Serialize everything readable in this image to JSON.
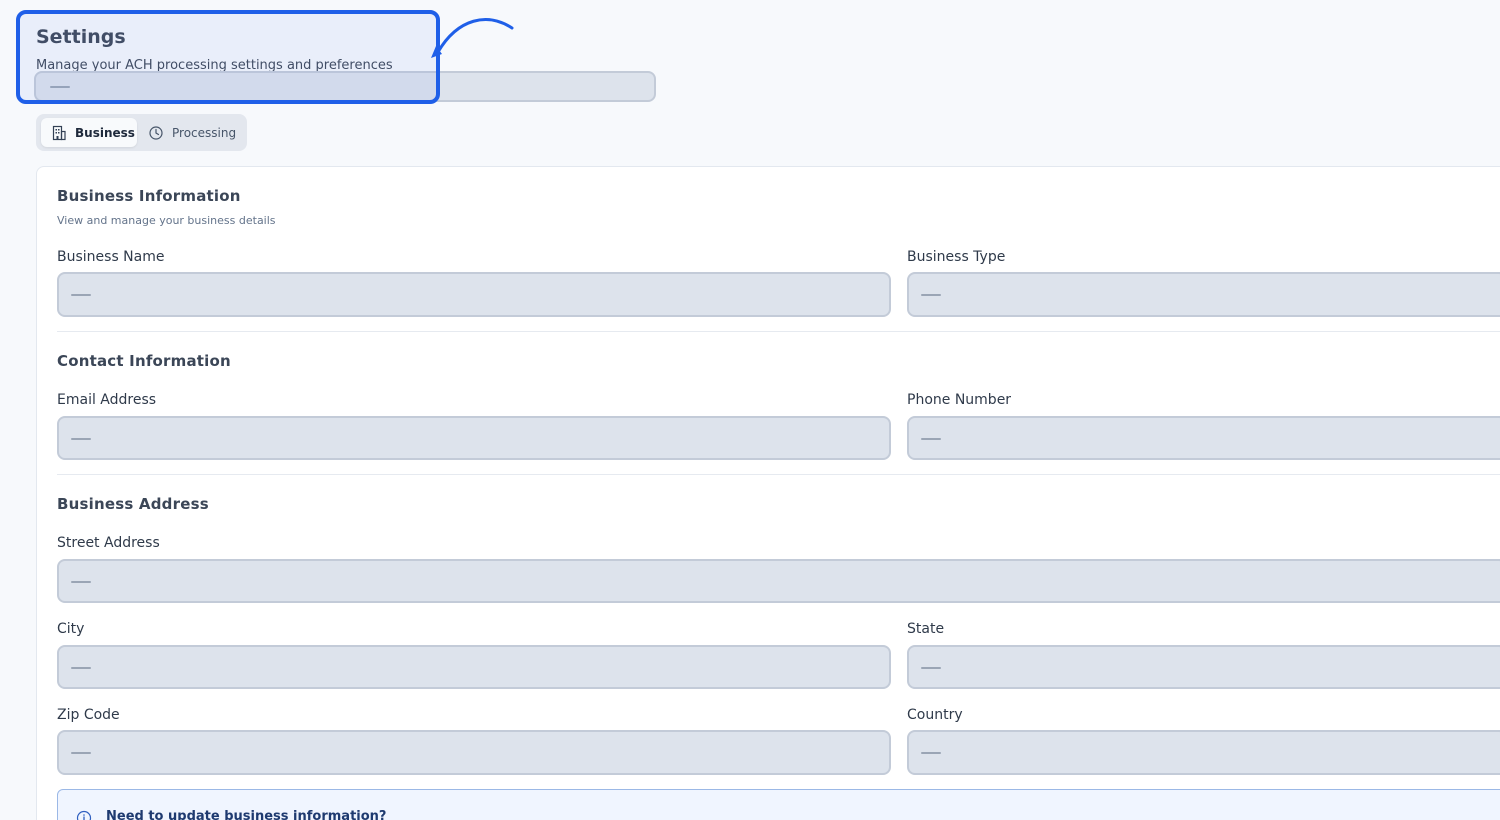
{
  "header": {
    "title": "Settings",
    "subtitle": "Manage your ACH processing settings and preferences"
  },
  "tabs": [
    {
      "label": "Business",
      "icon": "building-icon",
      "active": true
    },
    {
      "label": "Processing",
      "icon": "clock-icon",
      "active": false
    }
  ],
  "sections": {
    "business_info": {
      "title": "Business Information",
      "description": "View and manage your business details",
      "business_name_label": "Business Name",
      "business_type_label": "Business Type"
    },
    "contact_info": {
      "title": "Contact Information",
      "email_label": "Email Address",
      "phone_label": "Phone Number"
    },
    "business_address": {
      "title": "Business Address",
      "street_label": "Street Address",
      "city_label": "City",
      "state_label": "State",
      "zip_label": "Zip Code",
      "country_label": "Country"
    }
  },
  "banner": {
    "title": "Need to update business information?"
  },
  "colors": {
    "accent": "#1f5fe8",
    "field_bg": "#dde3ec",
    "banner_bg": "#f0f5ff"
  }
}
